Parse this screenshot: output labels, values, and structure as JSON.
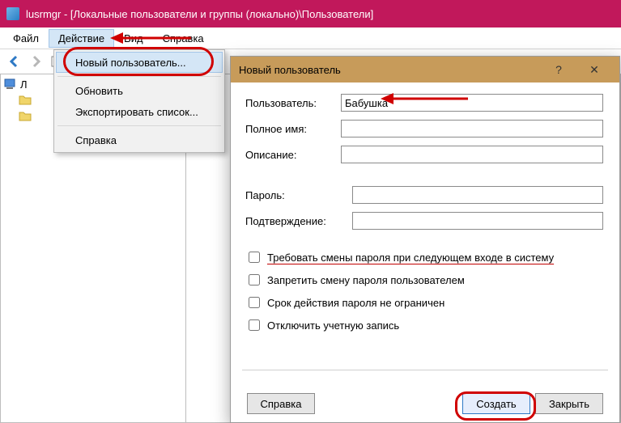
{
  "window": {
    "title": "lusrmgr - [Локальные пользователи и группы (локально)\\Пользователи]"
  },
  "menubar": {
    "file": "Файл",
    "action": "Действие",
    "view": "Вид",
    "help": "Справка"
  },
  "tree": {
    "root": "Л"
  },
  "dropdown": {
    "new_user": "Новый пользователь...",
    "refresh": "Обновить",
    "export": "Экспортировать список...",
    "help": "Справка"
  },
  "dialog": {
    "title": "Новый пользователь",
    "help_q": "?",
    "close_x": "✕",
    "labels": {
      "user": "Пользователь:",
      "fullname": "Полное имя:",
      "description": "Описание:",
      "password": "Пароль:",
      "confirm": "Подтверждение:"
    },
    "values": {
      "user": "Бабушка",
      "fullname": "",
      "description": "",
      "password": "",
      "confirm": ""
    },
    "checks": {
      "must_change": "Требовать смены пароля при следующем входе в систему",
      "cannot_change": "Запретить смену пароля пользователем",
      "never_expires": "Срок действия пароля не ограничен",
      "disabled": "Отключить учетную запись"
    },
    "buttons": {
      "help": "Справка",
      "create": "Создать",
      "close": "Закрыть"
    }
  }
}
